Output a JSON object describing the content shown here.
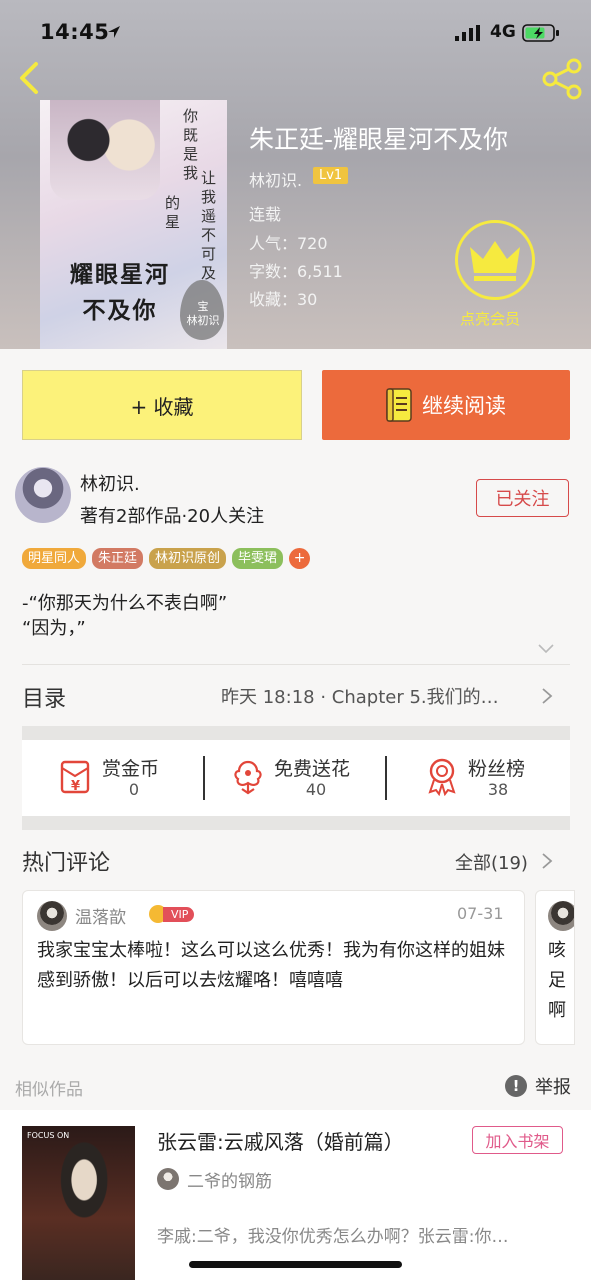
{
  "status_bar": {
    "time": "14:45",
    "network": "4G"
  },
  "book": {
    "cover": {
      "title_line1": "耀眼星河",
      "title_line2": "不及你",
      "vertical_col1": "你既是我",
      "vertical_col2": "让我遥不可及",
      "vertical_col3": "的星",
      "badge": "宝",
      "author": "林初识"
    },
    "title": "朱正廷-耀眼星河不及你",
    "author": "林初识.",
    "level": "Lv1",
    "status": "连载",
    "popularity": "人气：720",
    "word_count": "字数：6,511",
    "favorites": "收藏：30",
    "vip_label": "点亮会员"
  },
  "actions": {
    "collect_label": "+ 收藏",
    "read_label": "继续阅读"
  },
  "author_info": {
    "name": "林初识.",
    "works": "著有2部作品·20人关注",
    "follow_label": "已关注"
  },
  "tags": [
    {
      "label": "明星同人",
      "color": "#f0a93b"
    },
    {
      "label": "朱正廷",
      "color": "#d27a63"
    },
    {
      "label": "林初识原创",
      "color": "#c9a24c"
    },
    {
      "label": "毕雯珺",
      "color": "#8cbf5c"
    }
  ],
  "tag_more": "+",
  "intro": {
    "line1": "-“你那天为什么不表白啊”",
    "line2": "“因为，”"
  },
  "toc": {
    "label": "目录",
    "latest": "昨天 18:18 · Chapter 5.我们的…"
  },
  "stats": [
    {
      "label": "赏金币",
      "value": "0",
      "icon": "coin-envelope-icon"
    },
    {
      "label": "免费送花",
      "value": "40",
      "icon": "flower-icon"
    },
    {
      "label": "粉丝榜",
      "value": "38",
      "icon": "medal-icon"
    }
  ],
  "comments": {
    "title": "热门评论",
    "all_label": "全部(19)",
    "items": [
      {
        "user": "温落歆",
        "vip": "VIP",
        "date": "07-31",
        "text": "我家宝宝太棒啦！这么可以这么优秀！我为有你这样的姐妹感到骄傲！以后可以去炫耀咯！嘻嘻嘻"
      },
      {
        "text": "咳足啊"
      }
    ]
  },
  "similar": {
    "label": "相似作品",
    "report_label": "举报",
    "item": {
      "cover_text": "FOCUS ON",
      "title": "张云雷:云戚风落（婚前篇）",
      "add_label": "加入书架",
      "author": "二爷的钢筋",
      "desc": "李戚:二爷，我没你优秀怎么办啊？张云雷:你…"
    }
  },
  "colors": {
    "accent_orange": "#ec6a3c",
    "collect_yellow": "#fcf27a",
    "follow_red": "#d64a4a",
    "vip_yellow": "#f6ea3f"
  }
}
